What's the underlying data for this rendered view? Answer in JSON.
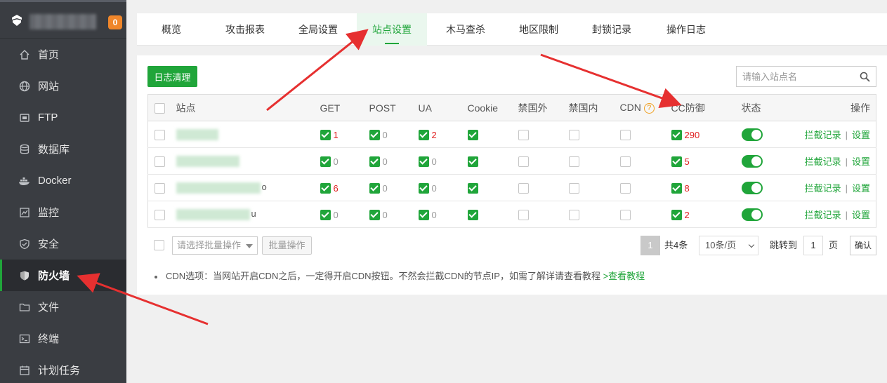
{
  "sidebar": {
    "badge": "0",
    "items": [
      {
        "label": "首页",
        "icon": "home-icon"
      },
      {
        "label": "网站",
        "icon": "globe-icon"
      },
      {
        "label": "FTP",
        "icon": "ftp-icon"
      },
      {
        "label": "数据库",
        "icon": "database-icon"
      },
      {
        "label": "Docker",
        "icon": "docker-icon"
      },
      {
        "label": "监控",
        "icon": "monitor-icon"
      },
      {
        "label": "安全",
        "icon": "shield-check-icon"
      },
      {
        "label": "防火墙",
        "icon": "firewall-shield-icon"
      },
      {
        "label": "文件",
        "icon": "folder-icon"
      },
      {
        "label": "终端",
        "icon": "terminal-icon"
      },
      {
        "label": "计划任务",
        "icon": "calendar-icon"
      }
    ]
  },
  "tabs": [
    "概览",
    "攻击报表",
    "全局设置",
    "站点设置",
    "木马查杀",
    "地区限制",
    "封锁记录",
    "操作日志"
  ],
  "active_tab": "站点设置",
  "toolbar": {
    "clear_log": "日志清理",
    "search_placeholder": "请输入站点名"
  },
  "table": {
    "headers": {
      "site": "站点",
      "get": "GET",
      "post": "POST",
      "ua": "UA",
      "cookie": "Cookie",
      "foreign": "禁国外",
      "domestic": "禁国内",
      "cdn": "CDN",
      "cdn_help": "?",
      "cc": "CC防御",
      "status": "状态",
      "actions": "操作"
    },
    "rows": [
      {
        "site_visible": "",
        "get": "1",
        "post": "0",
        "ua": "2",
        "cc": "290",
        "get_red": true,
        "ua_red": true
      },
      {
        "site_visible": "",
        "get": "0",
        "post": "0",
        "ua": "0",
        "cc": "5",
        "get_red": false,
        "ua_red": false
      },
      {
        "site_visible": "o",
        "get": "6",
        "post": "0",
        "ua": "0",
        "cc": "8",
        "get_red": true,
        "ua_red": false
      },
      {
        "site_visible": "u",
        "get": "0",
        "post": "0",
        "ua": "0",
        "cc": "2",
        "get_red": false,
        "ua_red": false
      }
    ],
    "intercept_label": "拦截记录",
    "separator": "|",
    "settings_label": "设置"
  },
  "batch": {
    "select_placeholder": "请选择批量操作",
    "button": "批量操作"
  },
  "pagination": {
    "current": "1",
    "total": "共4条",
    "page_size": "10条/页",
    "goto_label": "跳转到",
    "goto_value": "1",
    "page_label": "页",
    "confirm": "确认"
  },
  "note": {
    "text": "CDN选项：当网站开启CDN之后，一定得开启CDN按钮。不然会拦截CDN的节点IP，如需了解详请查看教程",
    "link": ">查看教程"
  }
}
